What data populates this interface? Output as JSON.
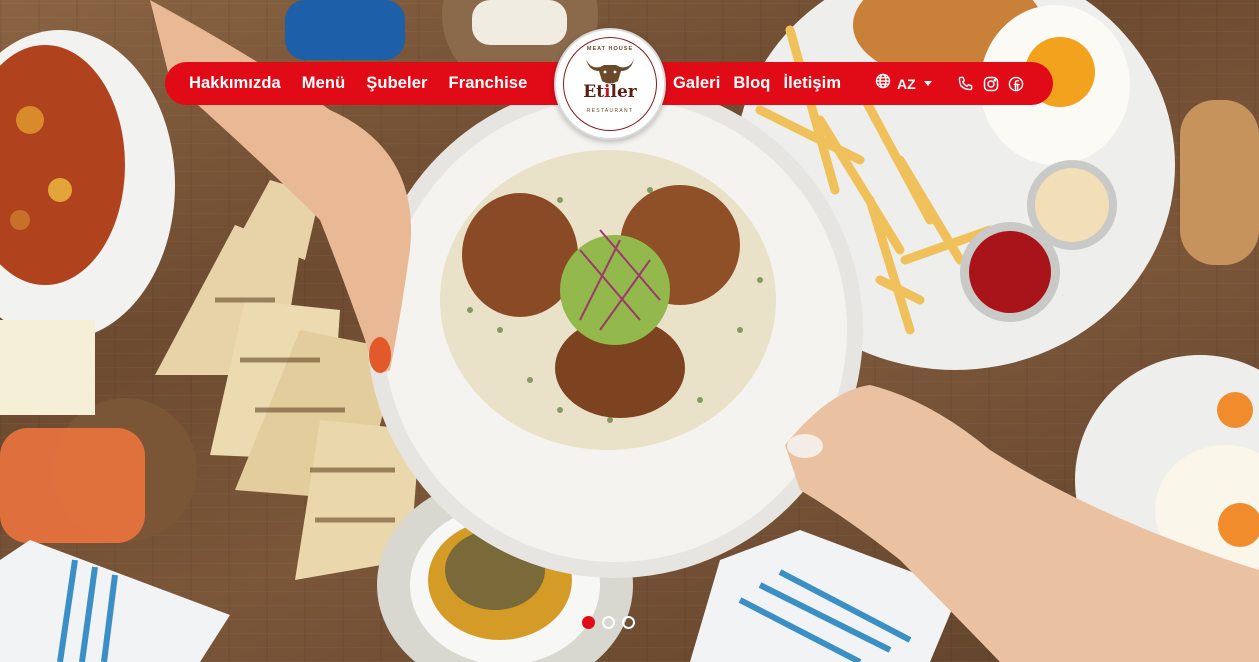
{
  "brand": {
    "logo_top": "MEAT HOUSE",
    "logo_name_prefix": "Et",
    "logo_name_accent": "i",
    "logo_name_suffix": "ler",
    "logo_bottom": "RESTAURANT",
    "accent_color": "#e10b17"
  },
  "nav": {
    "left": [
      {
        "label": "Hakkımızda"
      },
      {
        "label": "Menü"
      },
      {
        "label": "Şubeler"
      },
      {
        "label": "Franchise"
      }
    ],
    "right": [
      {
        "label": "Galeri"
      },
      {
        "label": "Bloq"
      },
      {
        "label": "İletişim"
      }
    ]
  },
  "language": {
    "current": "AZ",
    "icon": "globe-icon"
  },
  "socials": [
    {
      "icon": "phone-icon"
    },
    {
      "icon": "instagram-icon"
    },
    {
      "icon": "facebook-icon"
    }
  ],
  "slider": {
    "count": 3,
    "active_index": 0
  }
}
